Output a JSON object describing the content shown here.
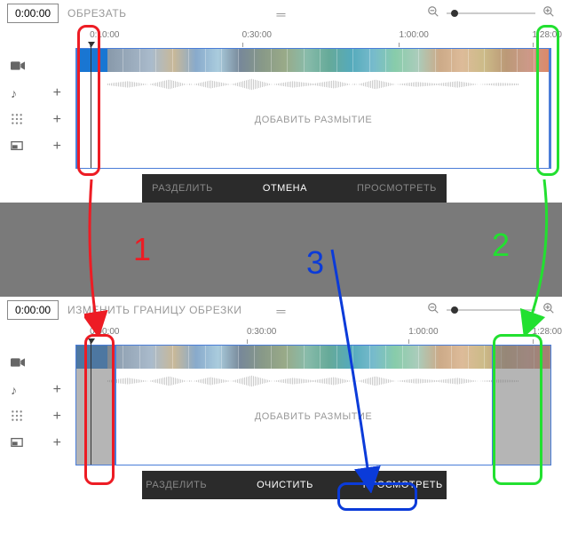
{
  "panel1": {
    "time": "0:00:00",
    "title": "ОБРЕЗАТЬ",
    "ruler": [
      "0:10:00",
      "0:30:00",
      "1:00:00",
      "1:28:00"
    ],
    "blur_label": "ДОБАВИТЬ РАЗМЫТИЕ",
    "buttons": {
      "b1": "РАЗДЕЛИТЬ",
      "b2": "ОТМЕНА",
      "b3": "ПРОСМОТРЕТЬ"
    }
  },
  "panel2": {
    "time": "0:00:00",
    "title": "ИЗМЕНИТЬ ГРАНИЦУ ОБРЕЗКИ",
    "ruler": [
      "0:00:00",
      "0:30:00",
      "1:00:00",
      "1:28:00"
    ],
    "blur_label": "ДОБАВИТЬ РАЗМЫТИЕ",
    "buttons": {
      "b1": "РАЗДЕЛИТЬ",
      "b2": "ОЧИСТИТЬ",
      "b3": "ПРОСМОТРЕТЬ"
    }
  },
  "annotations": {
    "n1": "1",
    "n2": "2",
    "n3": "3"
  },
  "colors": {
    "red": "#ed1c24",
    "green": "#22e030",
    "blue": "#0b3bd9"
  }
}
